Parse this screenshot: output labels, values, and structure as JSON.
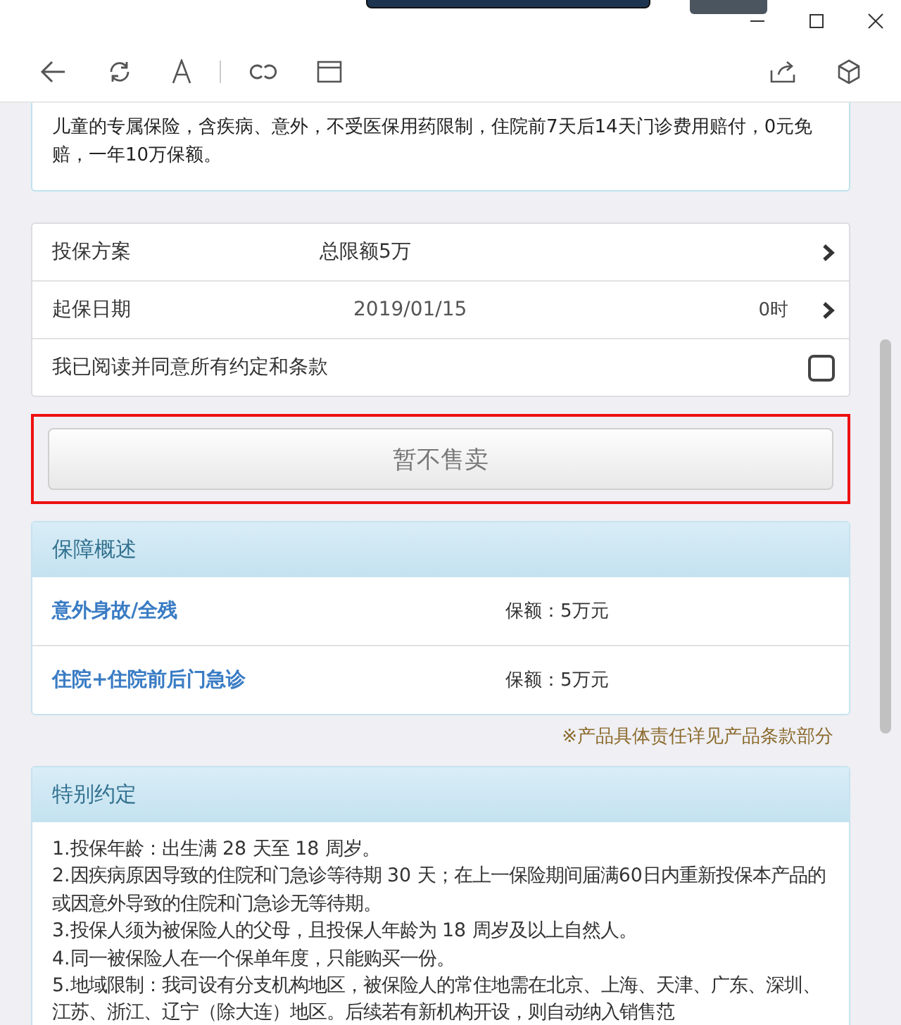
{
  "intro": {
    "text": "儿童的专属保险，含疾病、意外，不受医保用药限制，住院前7天后14天门诊费用赔付，0元免赔，一年10万保额。"
  },
  "form": [
    {
      "label": "投保方案",
      "value": "总限额5万"
    },
    {
      "label": "起保日期",
      "value": "2019/01/15",
      "extra": "0时"
    }
  ],
  "agreement": {
    "label": "我已阅读并同意所有约定和条款",
    "checked": false
  },
  "buy_button": {
    "label": "暂不售卖",
    "disabled": true,
    "highlighted": true
  },
  "summary": {
    "title": "保障概述",
    "rows": [
      {
        "name": "意外身故/全残",
        "amount": "保额：5万元"
      },
      {
        "name": "住院+住院前后门急诊",
        "amount": "保额：5万元"
      }
    ],
    "note": "※产品具体责任详见产品条款部分"
  },
  "special": {
    "title": "特别约定",
    "items": [
      "1.投保年龄：出生满 28 天至 18 周岁。",
      "2.因疾病原因导致的住院和门急诊等待期 30 天；在上一保险期间届满60日内重新投保本产品的或因意外导致的住院和门急诊无等待期。",
      "3.投保人须为被保险人的父母，且投保人年龄为 18 周岁及以上自然人。",
      "4.同一被保险人在一个保单年度，只能购买一份。",
      "5.地域限制：我司设有分支机构地区，被保险人的常住地需在北京、上海、天津、广东、深圳、江苏、浙江、辽宁（除大连）地区。后续若有新机构开设，则自动纳入销售范"
    ]
  }
}
